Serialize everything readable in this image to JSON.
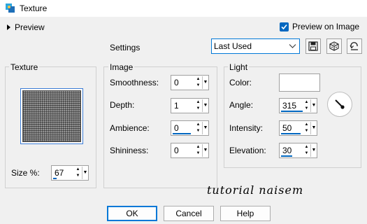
{
  "window": {
    "title": "Texture"
  },
  "top": {
    "preview_label": "Preview",
    "preview_on_image_label": "Preview on Image",
    "preview_on_image_checked": true,
    "settings_label": "Settings",
    "preset_value": "Last Used"
  },
  "texture": {
    "title": "Texture",
    "size_label": "Size %:",
    "size_value": "67"
  },
  "image": {
    "title": "Image",
    "smoothness_label": "Smoothness:",
    "smoothness_value": "0",
    "depth_label": "Depth:",
    "depth_value": "1",
    "ambience_label": "Ambience:",
    "ambience_value": "0",
    "shininess_label": "Shininess:",
    "shininess_value": "0"
  },
  "light": {
    "title": "Light",
    "color_label": "Color:",
    "color_value": "#ffffff",
    "angle_label": "Angle:",
    "angle_value": "315",
    "intensity_label": "Intensity:",
    "intensity_value": "50",
    "elevation_label": "Elevation:",
    "elevation_value": "30"
  },
  "watermark": "tutorial naisem",
  "buttons": {
    "ok": "OK",
    "cancel": "Cancel",
    "help": "Help"
  },
  "colors": {
    "accent": "#0067c0"
  }
}
